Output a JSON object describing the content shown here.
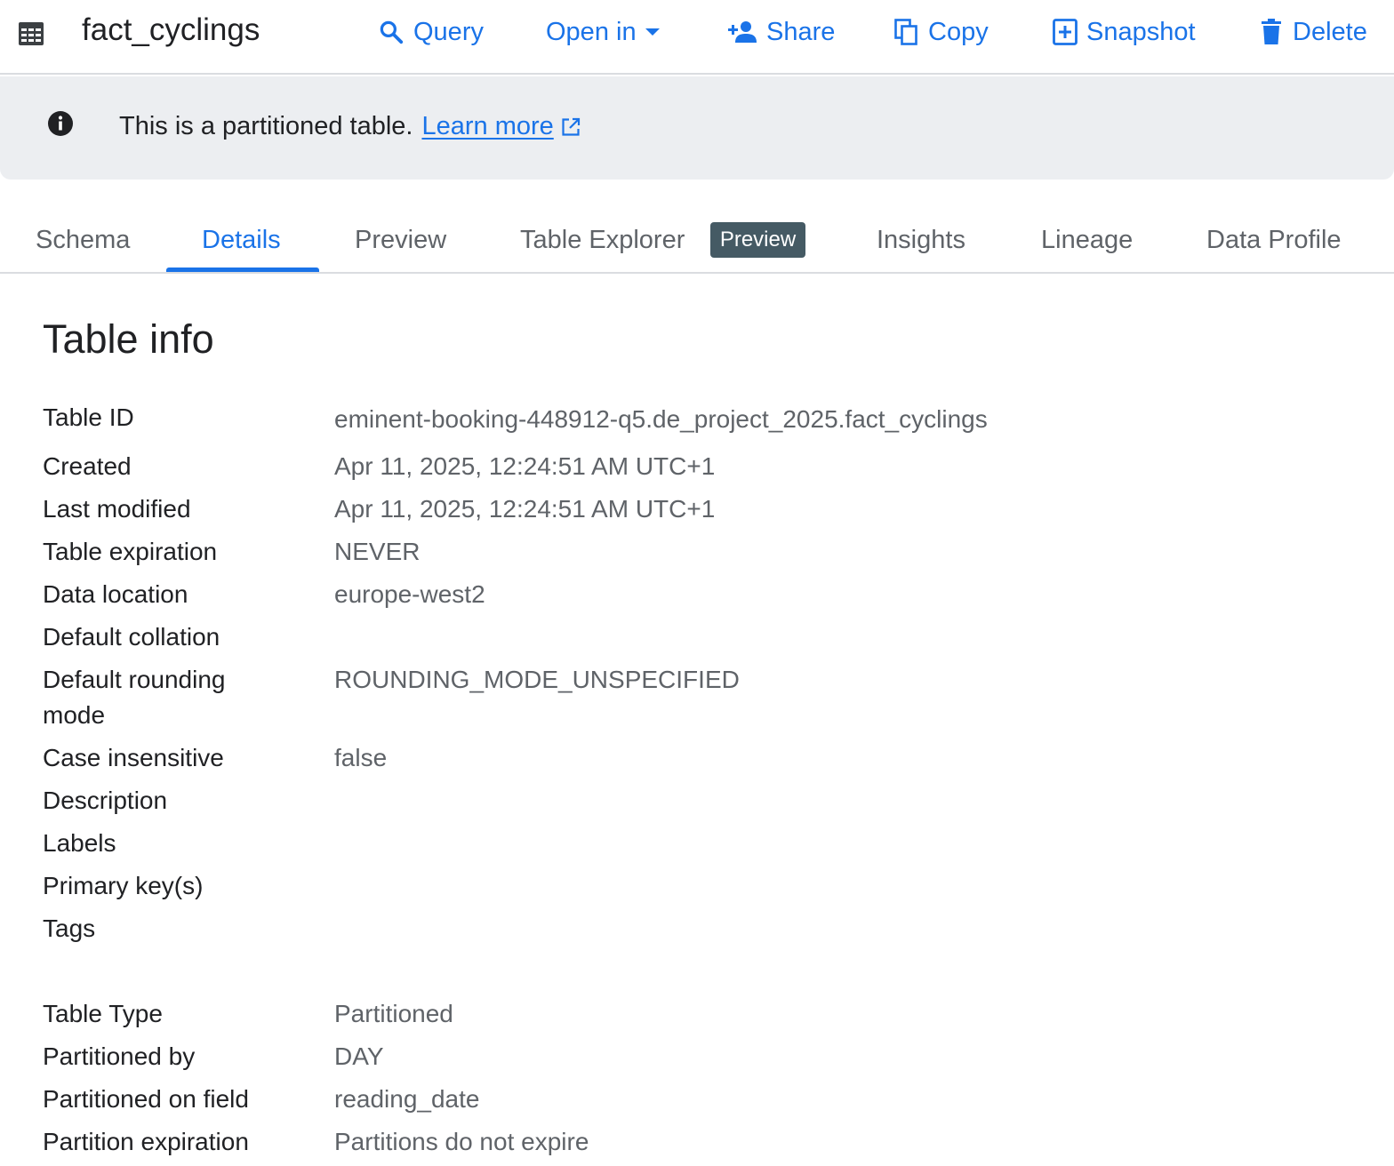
{
  "header": {
    "title": "fact_cyclings",
    "actions": {
      "query": "Query",
      "open_in": "Open in",
      "share": "Share",
      "copy": "Copy",
      "snapshot": "Snapshot",
      "delete": "Delete"
    },
    "accent_color": "#1a73e8"
  },
  "banner": {
    "message": "This is a partitioned table.",
    "link": "Learn more"
  },
  "tabs": {
    "items": [
      "Schema",
      "Details",
      "Preview",
      "Table Explorer",
      "Insights",
      "Lineage",
      "Data Profile"
    ],
    "active": "Details",
    "badge": "Preview"
  },
  "details": {
    "section_title": "Table info",
    "rows": [
      {
        "label": "Table ID",
        "value": "eminent-booking-448912-q5.de_project_2025.fact_cyclings"
      },
      {
        "label": "Created",
        "value": "Apr 11, 2025, 12:24:51 AM UTC+1"
      },
      {
        "label": "Last modified",
        "value": "Apr 11, 2025, 12:24:51 AM UTC+1"
      },
      {
        "label": "Table expiration",
        "value": "NEVER"
      },
      {
        "label": "Data location",
        "value": "europe-west2"
      },
      {
        "label": "Default collation",
        "value": ""
      },
      {
        "label": "Default rounding mode",
        "value": "ROUNDING_MODE_UNSPECIFIED"
      },
      {
        "label": "Case insensitive",
        "value": "false"
      },
      {
        "label": "Description",
        "value": ""
      },
      {
        "label": "Labels",
        "value": ""
      },
      {
        "label": "Primary key(s)",
        "value": ""
      },
      {
        "label": "Tags",
        "value": ""
      },
      {
        "label": "Table Type",
        "value": "Partitioned"
      },
      {
        "label": "Partitioned by",
        "value": "DAY"
      },
      {
        "label": "Partitioned on field",
        "value": "reading_date"
      },
      {
        "label": "Partition expiration",
        "value": "Partitions do not expire"
      }
    ]
  }
}
